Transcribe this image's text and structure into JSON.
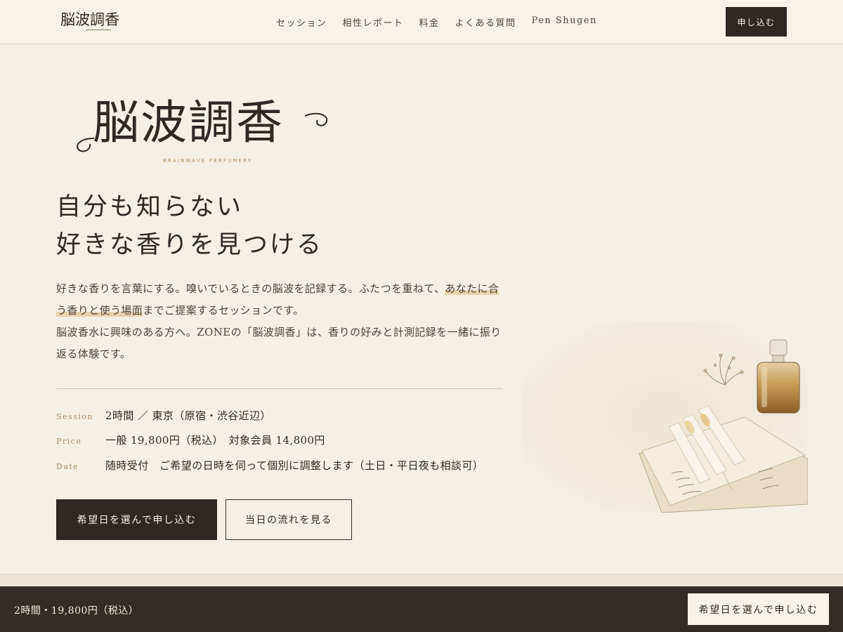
{
  "header": {
    "logo_text": "脳波調香",
    "nav": [
      {
        "label": "セッション"
      },
      {
        "label": "相性レポート"
      },
      {
        "label": "料金"
      },
      {
        "label": "よくある質問"
      },
      {
        "label": "Pen Shugen"
      }
    ],
    "cta_label": "申し込む"
  },
  "hero": {
    "logo_text": "脳波調香",
    "logo_sub": "BRAINWAVE PERFUMERY",
    "headline_line1": "自分も知らない",
    "headline_line2": "好きな香りを見つける",
    "body_part1": "好きな香りを言葉にする。嗅いでいるときの脳波を記録する。ふたつを重ねて、",
    "body_highlight": "あなたに合う香りと使う場面",
    "body_part2": "までご提案するセッションです。",
    "body_line3": "脳波香水に興味のある方へ。ZONEの「脳波調香」は、香りの好みと計測記録を一緒に振り返る体験です。"
  },
  "info": [
    {
      "label": "Session",
      "value": "2時間 ／ 東京（原宿・渋谷近辺）"
    },
    {
      "label": "Price",
      "value": "一般 19,800円（税込）　対象会員 14,800円"
    },
    {
      "label": "Date",
      "value": "随時受付　ご希望の日時を伺って個別に調整します（土日・平日夜も相談可）"
    }
  ],
  "buttons": {
    "primary_label": "希望日を選んで申し込む",
    "secondary_label": "当日の流れを見る"
  },
  "sticky": {
    "summary": "2時間・19,800円（税込）",
    "cta_label": "希望日を選んで申し込む"
  },
  "colors": {
    "background": "#f5f0e6",
    "ink": "#2e2925",
    "accent": "#a88a62",
    "highlight": "#e8d3a8"
  }
}
